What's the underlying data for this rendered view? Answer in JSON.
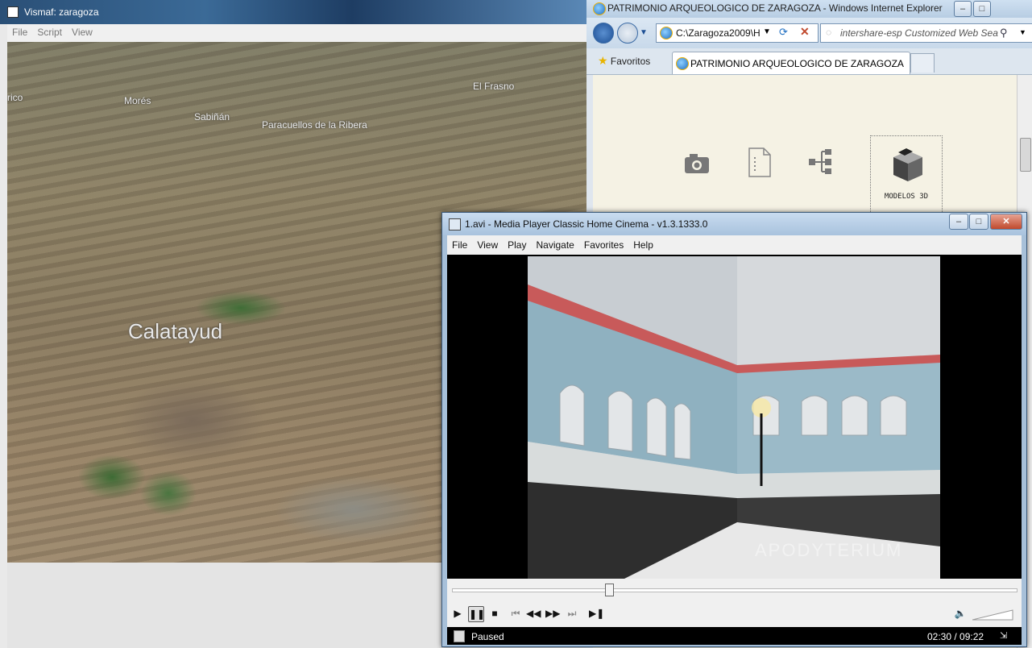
{
  "vismaf": {
    "title": "Vismaf: zaragoza",
    "menu": [
      "File",
      "Script",
      "View"
    ],
    "places": {
      "rico": "rico",
      "mores": "Morés",
      "sabinan": "Sabiñán",
      "paracuellos": "Paracuellos de la Ribera",
      "elfrasno": "El Frasno",
      "calatayud": "Calatayud"
    }
  },
  "ie": {
    "title": "PATRIMONIO ARQUEOLOGICO DE ZARAGOZA - Windows Internet Explorer",
    "address": "C:\\Zaragoza2009\\H",
    "search_placeholder": "intershare-esp Customized Web Sea",
    "favorites": "Favoritos",
    "tab_title": "PATRIMONIO ARQUEOLOGICO DE ZARAGOZA",
    "modelos_label": "MODELOS 3D"
  },
  "mpc": {
    "title": "1.avi - Media Player Classic Home Cinema - v1.3.1333.0",
    "menu": [
      "File",
      "View",
      "Play",
      "Navigate",
      "Favorites",
      "Help"
    ],
    "video_caption": "APODYTERIUM",
    "status": "Paused",
    "time": "02:30 / 09:22",
    "seek_fraction": 0.27
  },
  "colors": {
    "ie_accent": "#1f6fc2",
    "close_red": "#c0492d"
  }
}
